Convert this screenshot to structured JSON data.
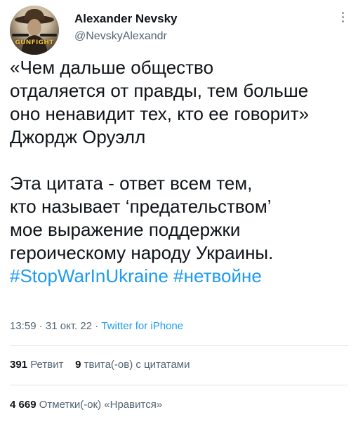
{
  "author": {
    "display_name": "Alexander Nevsky",
    "handle": "@NevskyAlexandr",
    "avatar_caption": "GUNFIGHT",
    "avatar_icon": "cowboy-avatar"
  },
  "more_icon": "vertical-ellipsis-icon",
  "tweet": {
    "lines": [
      "«Чем дальше общество",
      "отдаляется от правды, тем больше",
      "оно ненавидит тех, кто ее говорит»",
      "Джордж Оруэлл",
      "",
      "Эта цитата - ответ всем тем,",
      "кто называет ‘предательством’",
      "мое выражение поддержки",
      "героическому народу Украины."
    ],
    "hashtags": [
      "#StopWarInUkraine",
      "#нетвойне"
    ]
  },
  "meta": {
    "time": "13:59",
    "sep1": " · ",
    "date": "31 окт. 22",
    "sep2": " · ",
    "source": "Twitter for iPhone"
  },
  "stats": {
    "retweets_count": "391",
    "retweets_label": "Ретвит",
    "quotes_count": "9",
    "quotes_label": "твита(-ов) с цитатами",
    "likes_count": "4 669",
    "likes_label": "Отметки(-ок) «Нравится»"
  },
  "colors": {
    "text": "#0f1419",
    "secondary": "#536471",
    "link": "#1d9bf0",
    "divider": "#e1e5e9"
  }
}
